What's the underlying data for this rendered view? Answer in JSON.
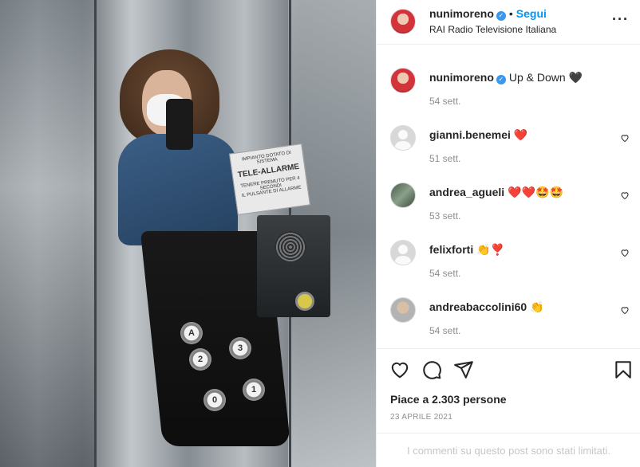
{
  "photo": {
    "sign_line1": "IMPIANTO DOTATO DI SISTEMA",
    "sign_title": "TELE-ALLARME",
    "sign_line2": "TENERE PREMUTO PER 4 SECONDI",
    "sign_line3": "IL PULSANTE DI ALLARME",
    "floor_buttons": [
      "A",
      "2",
      "3",
      "0",
      "1"
    ]
  },
  "header": {
    "username": "nunimoreno",
    "dot": "•",
    "follow_label": "Segui",
    "location": "RAI Radio Televisione Italiana",
    "more": "···"
  },
  "caption": {
    "username": "nunimoreno",
    "text": "Up & Down 🖤",
    "time": "54 sett."
  },
  "comments": [
    {
      "username": "gianni.benemei",
      "text": "❤️",
      "time": "51 sett."
    },
    {
      "username": "andrea_agueli",
      "text": "❤️❤️🤩🤩",
      "time": "53 sett."
    },
    {
      "username": "felixforti",
      "text": "👏❣️",
      "time": "54 sett."
    },
    {
      "username": "andreabaccolini60",
      "text": "👏",
      "time": "54 sett."
    }
  ],
  "actions": {
    "likes": "Piace a 2.303 persone",
    "date": "23 APRILE 2021",
    "limited": "I commenti su questo post sono stati limitati."
  },
  "icons": {
    "like": "heart-icon",
    "comment": "comment-icon",
    "share": "share-icon",
    "save": "bookmark-icon",
    "verified": "verified-badge-icon",
    "more": "more-options-icon"
  },
  "colors": {
    "accent": "#0095f6",
    "verified": "#3897f0",
    "muted": "#8e8e8e",
    "border": "#efefef"
  }
}
